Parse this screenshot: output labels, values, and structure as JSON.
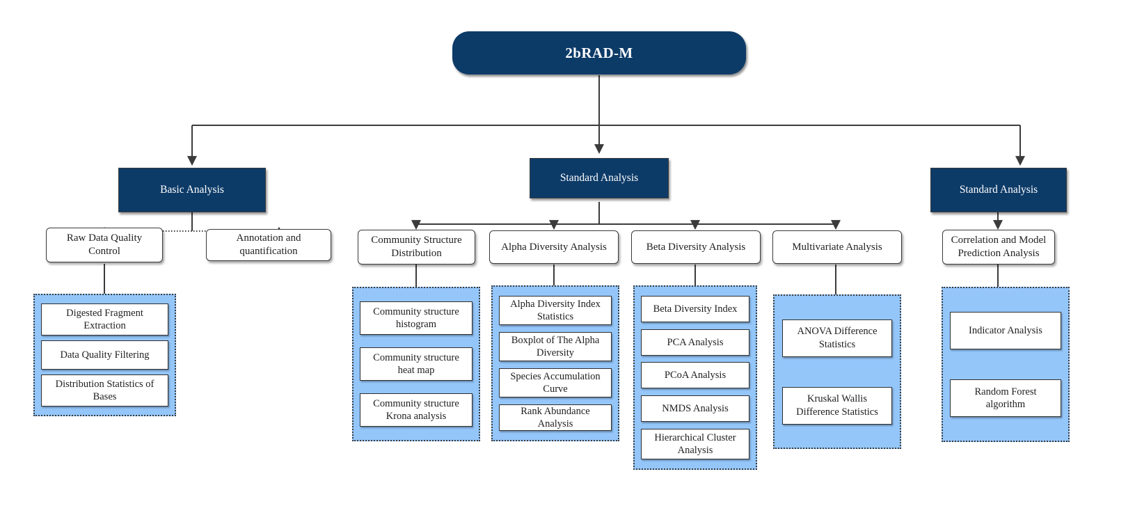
{
  "diagram": {
    "title": "2bRAD-M workflow chart",
    "colors": {
      "navy": "#0d3b68",
      "light_blue": "#94c6fa",
      "line": "#3b3b3b",
      "box_fill": "#ffffff"
    }
  },
  "root": {
    "label": "2bRAD-M"
  },
  "level2": [
    {
      "label": "Basic Analysis"
    },
    {
      "label": "Standard Analysis"
    },
    {
      "label": "Standard Analysis"
    }
  ],
  "level3": [
    {
      "label": "Raw Data Quality Control"
    },
    {
      "label": "Annotation and quantification"
    },
    {
      "label": "Community Structure Distribution"
    },
    {
      "label": "Alpha Diversity Analysis"
    },
    {
      "label": "Beta Diversity Analysis"
    },
    {
      "label": "Multivariate Analysis"
    },
    {
      "label": "Correlation and Model Prediction Analysis"
    }
  ],
  "groups": [
    {
      "name": "raw-data-quality-control-group",
      "items": [
        "Digested Fragment Extraction",
        "Data Quality Filtering",
        "Distribution Statistics of Bases"
      ]
    },
    {
      "name": "community-structure-group",
      "items": [
        "Community structure histogram",
        "Community structure heat map",
        "Community structure Krona analysis"
      ]
    },
    {
      "name": "alpha-diversity-group",
      "items": [
        "Alpha Diversity Index Statistics",
        "Boxplot of The Alpha Diversity",
        "Species Accumulation Curve",
        "Rank Abundance Analysis"
      ]
    },
    {
      "name": "beta-diversity-group",
      "items": [
        "Beta Diversity Index",
        "PCA Analysis",
        "PCoA Analysis",
        "NMDS Analysis",
        "Hierarchical Cluster Analysis"
      ]
    },
    {
      "name": "multivariate-group",
      "items": [
        "ANOVA Difference Statistics",
        "Kruskal Wallis Difference Statistics"
      ]
    },
    {
      "name": "correlation-model-group",
      "items": [
        "Indicator Analysis",
        "Random Forest algorithm"
      ]
    }
  ]
}
